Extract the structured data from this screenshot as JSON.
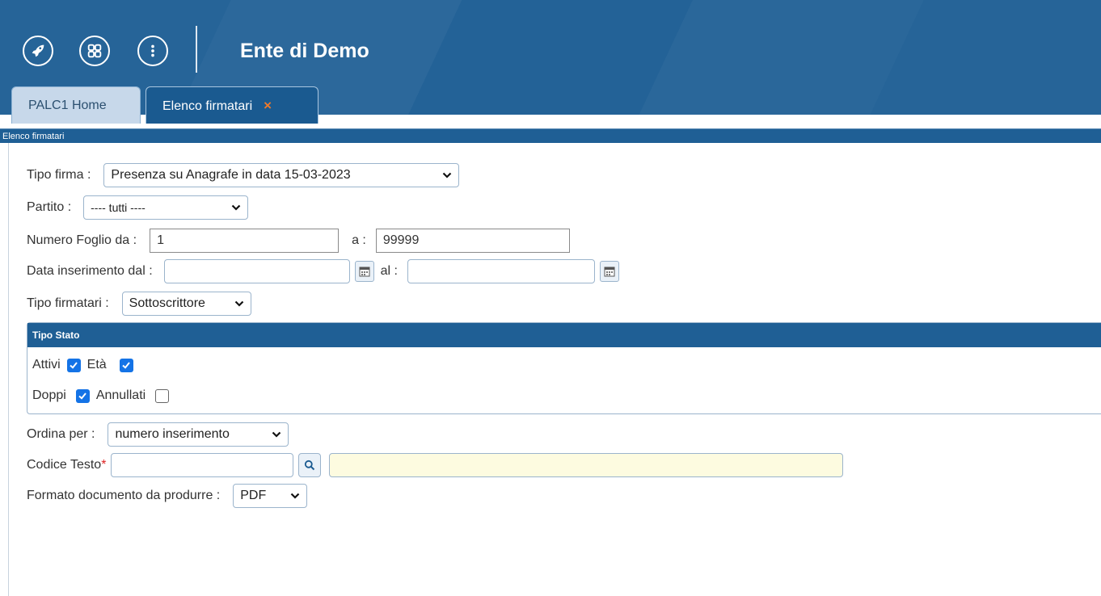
{
  "header": {
    "title": "Ente di Demo",
    "icons": [
      "rocket-icon",
      "apps-grid-icon",
      "more-vertical-icon"
    ],
    "colors": {
      "primary": "#1f5f95",
      "tab_close": "#f07a2a",
      "checkbox": "#1473e6"
    }
  },
  "tabs": [
    {
      "label": "PALC1 Home",
      "active": false
    },
    {
      "label": "Elenco firmatari",
      "active": true,
      "close_icon": "×"
    }
  ],
  "breadcrumb": "Elenco firmatari",
  "form": {
    "tipo_firma": {
      "label": "Tipo firma :",
      "value": "Presenza su Anagrafe in data 15-03-2023"
    },
    "partito": {
      "label": "Partito :",
      "value": "---- tutti ----"
    },
    "numero_foglio": {
      "label": "Numero Foglio da :",
      "from_value": "1",
      "to_label": "a :",
      "to_value": "99999"
    },
    "data_inserimento": {
      "label": "Data inserimento dal :",
      "from_value": "",
      "to_label": "al :",
      "to_value": ""
    },
    "tipo_firmatari": {
      "label": "Tipo firmatari :",
      "value": "Sottoscrittore"
    },
    "tipo_stato": {
      "title": "Tipo Stato",
      "attivi": {
        "label": "Attivi",
        "checked": true
      },
      "eta": {
        "label": "Età",
        "checked": true
      },
      "doppi": {
        "label": "Doppi",
        "checked": true
      },
      "annullati": {
        "label": "Annullati",
        "checked": false
      }
    },
    "ordina_per": {
      "label": "Ordina per :",
      "value": "numero inserimento"
    },
    "codice_testo": {
      "label": "Codice Testo",
      "required_mark": "*",
      "value": "",
      "description": ""
    },
    "formato_documento": {
      "label": "Formato documento da produrre :",
      "value": "PDF"
    }
  }
}
